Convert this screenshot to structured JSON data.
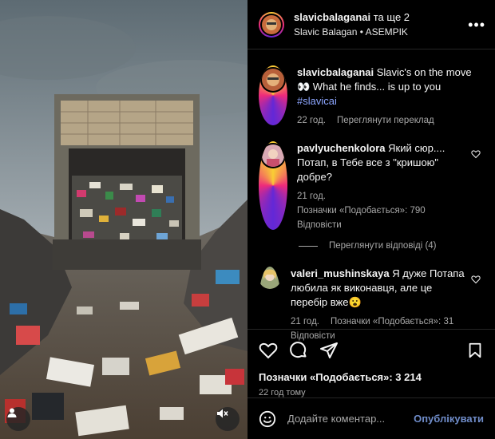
{
  "header": {
    "author": "slavicbalaganai",
    "and_more": "та ще 2",
    "subtitle": "Slavic Balagan • ASEMPIK",
    "more_icon": "more-dots-icon"
  },
  "caption": {
    "username": "slavicbalaganai",
    "text": "Slavic's on the move 👀 What he finds... is up to you",
    "hashtag": "#slavicai",
    "time": "22 год.",
    "translate": "Переглянути переклад"
  },
  "comments": [
    {
      "username": "pavlyuchenkolora",
      "text": "Який сюр.... Потап, в Тебе все з \"кришою\" добре?",
      "time": "21 год.",
      "likes": "Позначки «Подобається»: 790",
      "reply": "Відповісти"
    },
    {
      "username": "valeri_mushinskaya",
      "text": "Я дуже Потапа любила як виконавця, але це перебір вже😮",
      "time": "21 год.",
      "likes": "Позначки «Подобається»: 31",
      "reply": "Відповісти"
    }
  ],
  "view_replies": "Переглянути відповіді (4)",
  "post": {
    "likes": "Позначки «Подобається»: 3 214",
    "time": "22 год тому"
  },
  "composer": {
    "placeholder": "Додайте коментар...",
    "publish": "Опублікувати"
  },
  "colors": {
    "background": "#000000",
    "link": "#8da6ff",
    "publish": "#6f8cc9",
    "muted": "#a8a8a8"
  }
}
